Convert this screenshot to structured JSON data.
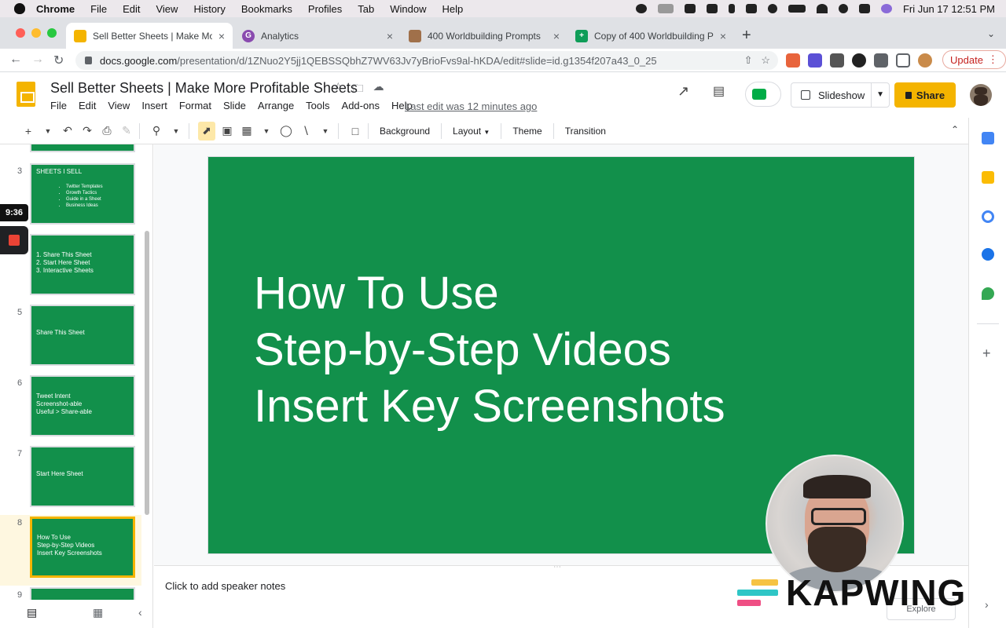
{
  "menubar": {
    "app": "Chrome",
    "items": [
      "File",
      "Edit",
      "View",
      "History",
      "Bookmarks",
      "Profiles",
      "Tab",
      "Window",
      "Help"
    ],
    "datetime": "Fri Jun 17  12:51 PM"
  },
  "tabs": [
    {
      "title": "Sell Better Sheets | Make More",
      "favicon": "slides-icon",
      "active": true
    },
    {
      "title": "Analytics",
      "favicon": "analytics-icon",
      "active": false
    },
    {
      "title": "400 Worldbuilding Prompts",
      "favicon": "avatar-icon",
      "active": false
    },
    {
      "title": "Copy of 400 Worldbuilding Pro",
      "favicon": "sheets-icon",
      "active": false
    }
  ],
  "address": {
    "host": "docs.google.com",
    "path": "/presentation/d/1ZNuo2Y5jj1QEBSSQbhZ7WV63Jv7yBrioFvs9al-hKDA/edit#slide=id.g1354f207a43_0_25",
    "update_label": "Update"
  },
  "doc": {
    "title": "Sell Better Sheets | Make More Profitable Sheets",
    "menu": [
      "File",
      "Edit",
      "View",
      "Insert",
      "Format",
      "Slide",
      "Arrange",
      "Tools",
      "Add-ons",
      "Help"
    ],
    "last_edit": "Last edit was 12 minutes ago",
    "slideshow_label": "Slideshow",
    "share_label": "Share"
  },
  "toolbar": {
    "background": "Background",
    "layout": "Layout",
    "theme": "Theme",
    "transition": "Transition"
  },
  "filmstrip": {
    "timer": "9:36",
    "slides": [
      {
        "num": "3",
        "title": "SHEETS I SELL",
        "bullets": [
          "Twitter Templates",
          "Growth Tactics",
          "Guide in a Sheet",
          "Business Ideas"
        ]
      },
      {
        "num": "",
        "lines": [
          "1.  Share This Sheet",
          "2.  Start Here Sheet",
          "3.  Interactive Sheets"
        ]
      },
      {
        "num": "5",
        "lines": [
          "Share This Sheet"
        ]
      },
      {
        "num": "6",
        "lines": [
          "Tweet Intent",
          "Screenshot-able",
          "Useful > Share-able"
        ]
      },
      {
        "num": "7",
        "lines": [
          "Start Here Sheet"
        ]
      },
      {
        "num": "8",
        "lines": [
          "How To Use",
          "Step-by-Step Videos",
          "Insert Key Screenshots"
        ],
        "active": true
      },
      {
        "num": "9",
        "lines": []
      }
    ]
  },
  "slide": {
    "lines": [
      "How To Use",
      "Step-by-Step Videos",
      "Insert Key Screenshots"
    ],
    "bg_color": "#12904b"
  },
  "notes": {
    "placeholder": "Click to add speaker notes"
  },
  "explore_label": "Explore",
  "watermark": "KAPWING",
  "colors": {
    "slide_green": "#12904b",
    "share_yellow": "#f4b400",
    "accent_active": "#f4b400"
  }
}
